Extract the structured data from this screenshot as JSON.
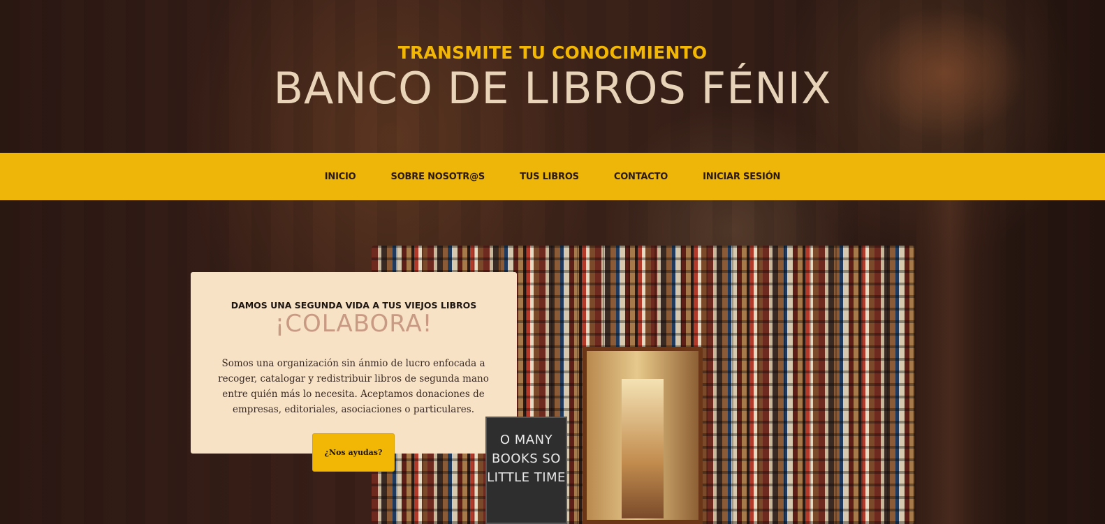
{
  "header": {
    "tagline": "TRANSMITE TU CONOCIMIENTO",
    "title": "BANCO DE LIBROS FÉNIX"
  },
  "nav": {
    "items": [
      {
        "label": "INICIO"
      },
      {
        "label": "SOBRE NOSOTR@S"
      },
      {
        "label": "TUS LIBROS"
      },
      {
        "label": "CONTACTO"
      },
      {
        "label": "INICIAR SESIÓN"
      }
    ]
  },
  "hero": {
    "chalkboard_text": "O MANY BOOKS SO LITTLE TIME"
  },
  "card": {
    "kicker": "DAMOS UNA SEGUNDA VIDA A TUS VIEJOS LIBROS",
    "title": "¡COLABORA!",
    "body": "Somos una organización sin ánmio de lucro enfocada a recoger, catalogar y redistribuir libros de segunda mano entre quién más lo necesita. Aceptamos donaciones de empresas, editoriales, asociaciones o particulares.",
    "button_label": "¿Nos ayudas?"
  },
  "colors": {
    "accent": "#eeb608",
    "card_bg": "#f7e2c6",
    "background": "#2a1712"
  }
}
